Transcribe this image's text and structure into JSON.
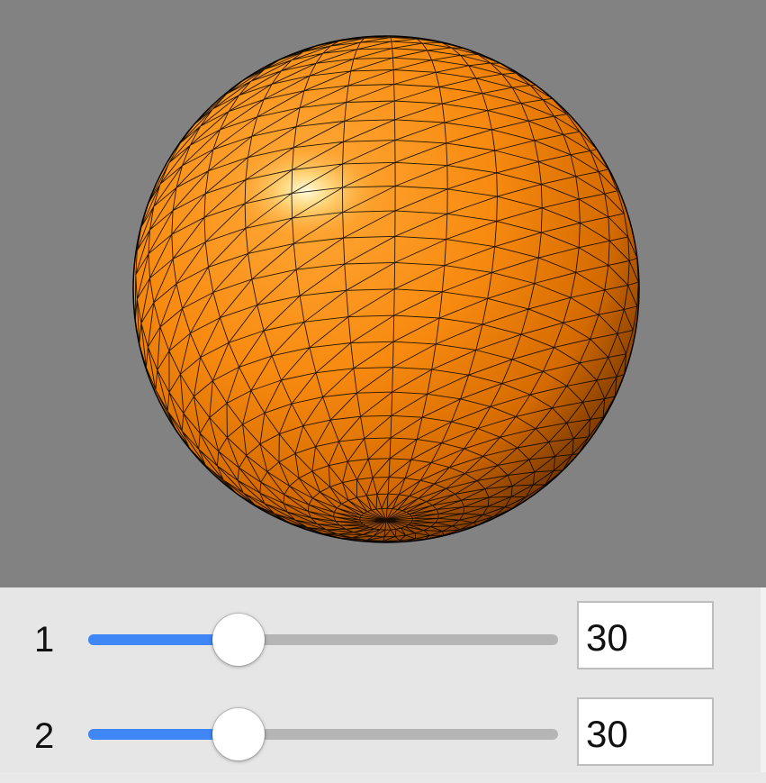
{
  "viewport": {
    "background": "#828282",
    "object": "sphere",
    "sphere_color": "#ff8c00",
    "mesh_color": "#000000"
  },
  "sliders": [
    {
      "label": "1",
      "value": "30",
      "fraction": 0.32
    },
    {
      "label": "2",
      "value": "30",
      "fraction": 0.32
    }
  ],
  "accent_color": "#3f86f7"
}
